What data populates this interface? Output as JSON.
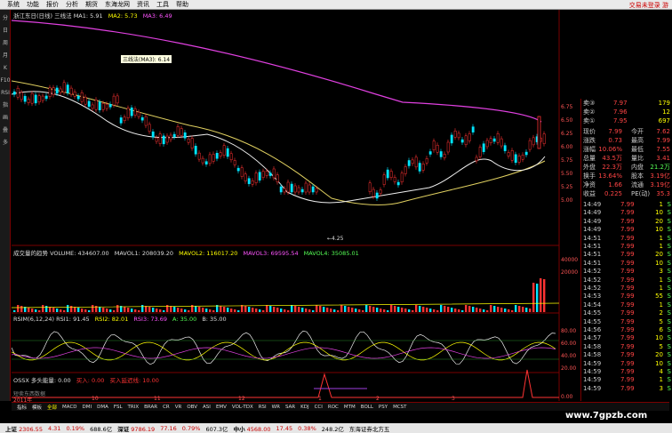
{
  "menu": [
    "系统",
    "功能",
    "报价",
    "分析",
    "期货",
    "东海龙网",
    "资讯",
    "工具",
    "帮助"
  ],
  "menu_right": "交易未登录 游",
  "left_tools": [
    "分",
    "日",
    "周",
    "月",
    "K",
    "F10",
    "RSI",
    "指",
    "画",
    "叠",
    "多"
  ],
  "main_panel": {
    "title": "浙江东日(日线) 三线法 MA1: 5.91",
    "ma2": "MA2: 5.73",
    "ma3": "MA3: 6.49",
    "low_mark": "←4.25",
    "tooltip": "三线法(MA3): 6.14",
    "axis": [
      "6.75",
      "6.50",
      "6.25",
      "6.00",
      "5.75",
      "5.50",
      "5.25",
      "5.00"
    ]
  },
  "volume_panel": {
    "title": "成交量的趋势 VOLUME: 434607.00",
    "mavol1": "MAVOL1: 208039.20",
    "mavol2": "MAVOL2: 116017.20",
    "mavol3": "MAVOL3: 69595.54",
    "mavol4": "MAVOL4: 35085.01",
    "axis": [
      "40000",
      "20000"
    ]
  },
  "rsi_panel": {
    "title": "RSIM(6,12,24) RSI1: 91.45",
    "rsi2": "RSI2: 82.01",
    "rsi3": "RSI3: 73.69",
    "a": "A: 35.00",
    "b": "B: 35.00",
    "axis": [
      "80.00",
      "60.00",
      "40.00",
      "20.00"
    ]
  },
  "ossx_panel": {
    "title": "OSSX 多头能量: 0.00",
    "buy1": "买入: 0.00",
    "buy2": "买入延迟线: 10.00",
    "axis": [
      "0.00"
    ],
    "note": "短卖东西数据"
  },
  "date_labels": [
    "2011年",
    "10",
    "11",
    "12",
    "1",
    "2",
    "3"
  ],
  "tabs": [
    "指标",
    "模板",
    "全部",
    "MACD",
    "DMI",
    "DMA",
    "FSL",
    "TRIX",
    "BRAR",
    "CR",
    "VR",
    "OBV",
    "ASI",
    "EMV",
    "VOL-TDX",
    "RSI",
    "WR",
    "SAR",
    "KDJ",
    "CCI",
    "ROC",
    "MTM",
    "BOLL",
    "PSY",
    "MCST"
  ],
  "quote": {
    "asks": [
      {
        "label": "卖③",
        "price": "7.97",
        "vol": "179"
      },
      {
        "label": "卖②",
        "price": "7.96",
        "vol": "12"
      },
      {
        "label": "卖①",
        "price": "7.95",
        "vol": "697"
      }
    ],
    "stats": [
      {
        "l": "现价",
        "v": "7.99",
        "l2": "今开",
        "v2": "7.62"
      },
      {
        "l": "涨跌",
        "v": "0.73",
        "l2": "最高",
        "v2": "7.99"
      },
      {
        "l": "涨幅",
        "v": "10.06%",
        "l2": "最低",
        "v2": "7.55"
      },
      {
        "l": "总量",
        "v": "43.5万",
        "l2": "量比",
        "v2": "3.41"
      },
      {
        "l": "外盘",
        "v": "22.3万",
        "l2": "内盘",
        "v2": "21.2万"
      },
      {
        "l": "换手",
        "v": "13.64%",
        "l2": "股本",
        "v2": "3.19亿"
      },
      {
        "l": "净资",
        "v": "1.66",
        "l2": "流通",
        "v2": "3.19亿"
      },
      {
        "l": "收益",
        "v": "0.225",
        "l2": "PE(动)",
        "v2": "35.3"
      }
    ],
    "ticks": [
      {
        "t": "14:49",
        "p": "7.99",
        "v": "1",
        "s": "S"
      },
      {
        "t": "14:49",
        "p": "7.99",
        "v": "10",
        "s": "S"
      },
      {
        "t": "14:49",
        "p": "7.99",
        "v": "20",
        "s": "S"
      },
      {
        "t": "14:49",
        "p": "7.99",
        "v": "10",
        "s": "S"
      },
      {
        "t": "14:51",
        "p": "7.99",
        "v": "1",
        "s": "S"
      },
      {
        "t": "14:51",
        "p": "7.99",
        "v": "1",
        "s": "S"
      },
      {
        "t": "14:51",
        "p": "7.99",
        "v": "20",
        "s": "S"
      },
      {
        "t": "14:51",
        "p": "7.99",
        "v": "10",
        "s": "S"
      },
      {
        "t": "14:52",
        "p": "7.99",
        "v": "3",
        "s": "S"
      },
      {
        "t": "14:52",
        "p": "7.99",
        "v": "1",
        "s": "S"
      },
      {
        "t": "14:52",
        "p": "7.99",
        "v": "1",
        "s": "S"
      },
      {
        "t": "14:53",
        "p": "7.99",
        "v": "55",
        "s": "S"
      },
      {
        "t": "14:54",
        "p": "7.99",
        "v": "1",
        "s": "S"
      },
      {
        "t": "14:55",
        "p": "7.99",
        "v": "2",
        "s": "S"
      },
      {
        "t": "14:55",
        "p": "7.99",
        "v": "5",
        "s": "S"
      },
      {
        "t": "14:56",
        "p": "7.99",
        "v": "6",
        "s": "S"
      },
      {
        "t": "14:57",
        "p": "7.99",
        "v": "10",
        "s": "S"
      },
      {
        "t": "14:58",
        "p": "7.99",
        "v": "5",
        "s": "S"
      },
      {
        "t": "14:58",
        "p": "7.99",
        "v": "20",
        "s": "S"
      },
      {
        "t": "14:59",
        "p": "7.99",
        "v": "10",
        "s": "S"
      },
      {
        "t": "14:59",
        "p": "7.99",
        "v": "4",
        "s": "S"
      },
      {
        "t": "14:59",
        "p": "7.99",
        "v": "1",
        "s": "S"
      },
      {
        "t": "14:59",
        "p": "7.99",
        "v": "3",
        "s": "S"
      }
    ],
    "mini_price": "0.00",
    "mini_flag": "沪"
  },
  "status": {
    "sh_label": "上证",
    "sh_value": "2306.55",
    "sh_chg": "4.31",
    "sh_pct": "0.19%",
    "sh_amt": "688.6亿",
    "sz_label": "深证",
    "sz_value": "9786.19",
    "sz_chg": "77.16",
    "sz_pct": "0.79%",
    "sz_amt": "607.3亿",
    "zx_label": "中小",
    "zx_value": "4568.00",
    "zx_chg": "17.45",
    "zx_pct": "0.38%",
    "zx_amt": "248.2亿",
    "broker": "东海证券北方五"
  },
  "watermark": "www.7gpzb.com",
  "colors": {
    "up": "#ff3333",
    "down": "#00ffff",
    "ma1": "#ffffff",
    "ma2": "#ffff00",
    "ma3": "#ff55ff",
    "axis": "#7a0000"
  }
}
